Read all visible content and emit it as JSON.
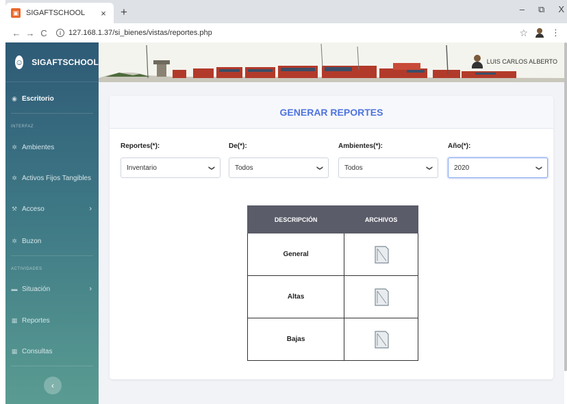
{
  "browser": {
    "tab_title": "SIGAFTSCHOOL",
    "tab_close": "×",
    "new_tab": "+",
    "url": "127.168.1.37/si_bienes/vistas/reportes.php",
    "controls": {
      "minimize": "–",
      "restore": "⧉",
      "close": "X"
    }
  },
  "sidebar": {
    "brand": "SIGAFTSCHOOL",
    "items": [
      {
        "label": "Escritorio"
      },
      {
        "label": "Ambientes"
      },
      {
        "label": "Activos Fijos Tangibles"
      },
      {
        "label": "Acceso",
        "chevron": "›"
      },
      {
        "label": "Buzon"
      },
      {
        "label": "Situación",
        "chevron": "›"
      },
      {
        "label": "Reportes"
      },
      {
        "label": "Consultas"
      }
    ],
    "headings": {
      "interfaz": "INTERFAZ",
      "actividades": "ACTIVIDADES"
    },
    "toggle": "‹"
  },
  "topbar": {
    "user_name": "LUIS CARLOS ALBERTO"
  },
  "card": {
    "title": "GENERAR REPORTES",
    "filters": [
      {
        "label": "Reportes(*):",
        "value": "Inventario"
      },
      {
        "label": "De(*):",
        "value": "Todos"
      },
      {
        "label": "Ambientes(*):",
        "value": "Todos"
      },
      {
        "label": "Año(*):",
        "value": "2020"
      }
    ],
    "table": {
      "headers": [
        "DESCRIPCIÓN",
        "ARCHIVOS"
      ],
      "rows": [
        {
          "description": "General",
          "file_icon": "document-icon"
        },
        {
          "description": "Altas",
          "file_icon": "document-icon"
        },
        {
          "description": "Bajas",
          "file_icon": "document-icon"
        }
      ]
    }
  },
  "colors": {
    "sidebar_top": "#2e5a76",
    "sidebar_bottom": "#5a9c92",
    "title_accent": "#4e73df",
    "table_header": "#5a5c69"
  }
}
